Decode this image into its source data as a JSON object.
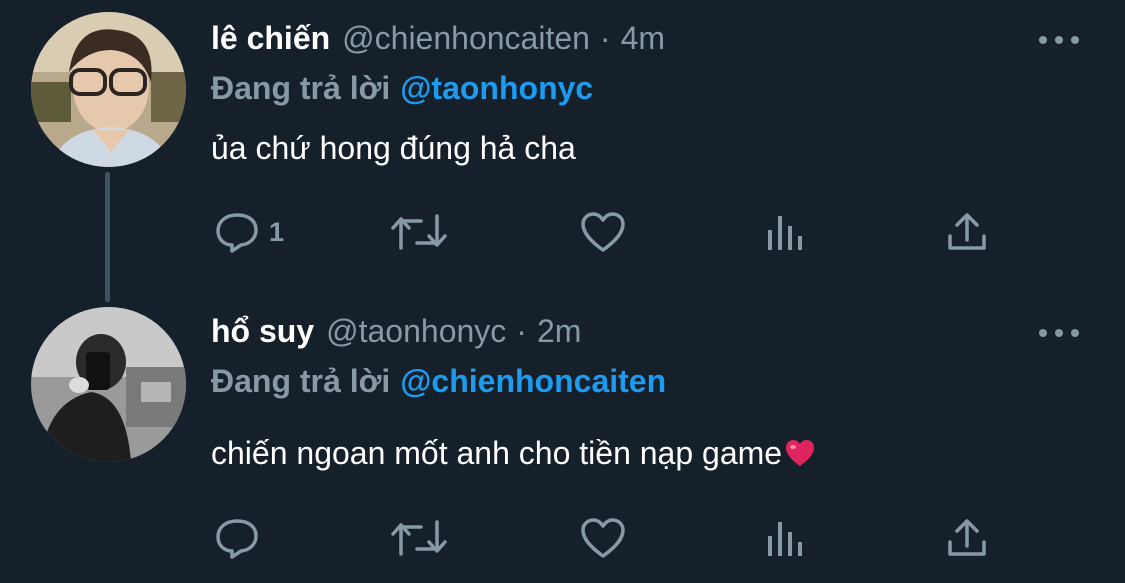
{
  "tweets": [
    {
      "display_name": "lê chiến",
      "handle": "@chienhoncaiten",
      "separator": "·",
      "time": "4m",
      "reply_label": "Đang trả lời",
      "reply_mention": "@taonhonyc",
      "text": "ủa chứ hong đúng hả cha",
      "reply_count": "1",
      "emoji": ""
    },
    {
      "display_name": "hổ suy",
      "handle": "@taonhonyc",
      "separator": "·",
      "time": "2m",
      "reply_label": "Đang trả lời",
      "reply_mention": "@chienhoncaiten",
      "text": "chiến ngoan mốt anh cho tiền nạp game",
      "reply_count": "",
      "emoji": "red-heart"
    }
  ],
  "icons": {
    "reply": "reply-bubble-icon",
    "retweet": "retweet-icon",
    "like": "heart-outline-icon",
    "analytics": "analytics-bars-icon",
    "share": "share-upload-icon",
    "more": "more-dots-icon"
  },
  "colors": {
    "background": "#15202b",
    "text_primary": "#ffffff",
    "text_secondary": "#8899a6",
    "link": "#1d9bf0",
    "thread_line": "#3d5466",
    "heart_emoji": "#e0245e"
  }
}
